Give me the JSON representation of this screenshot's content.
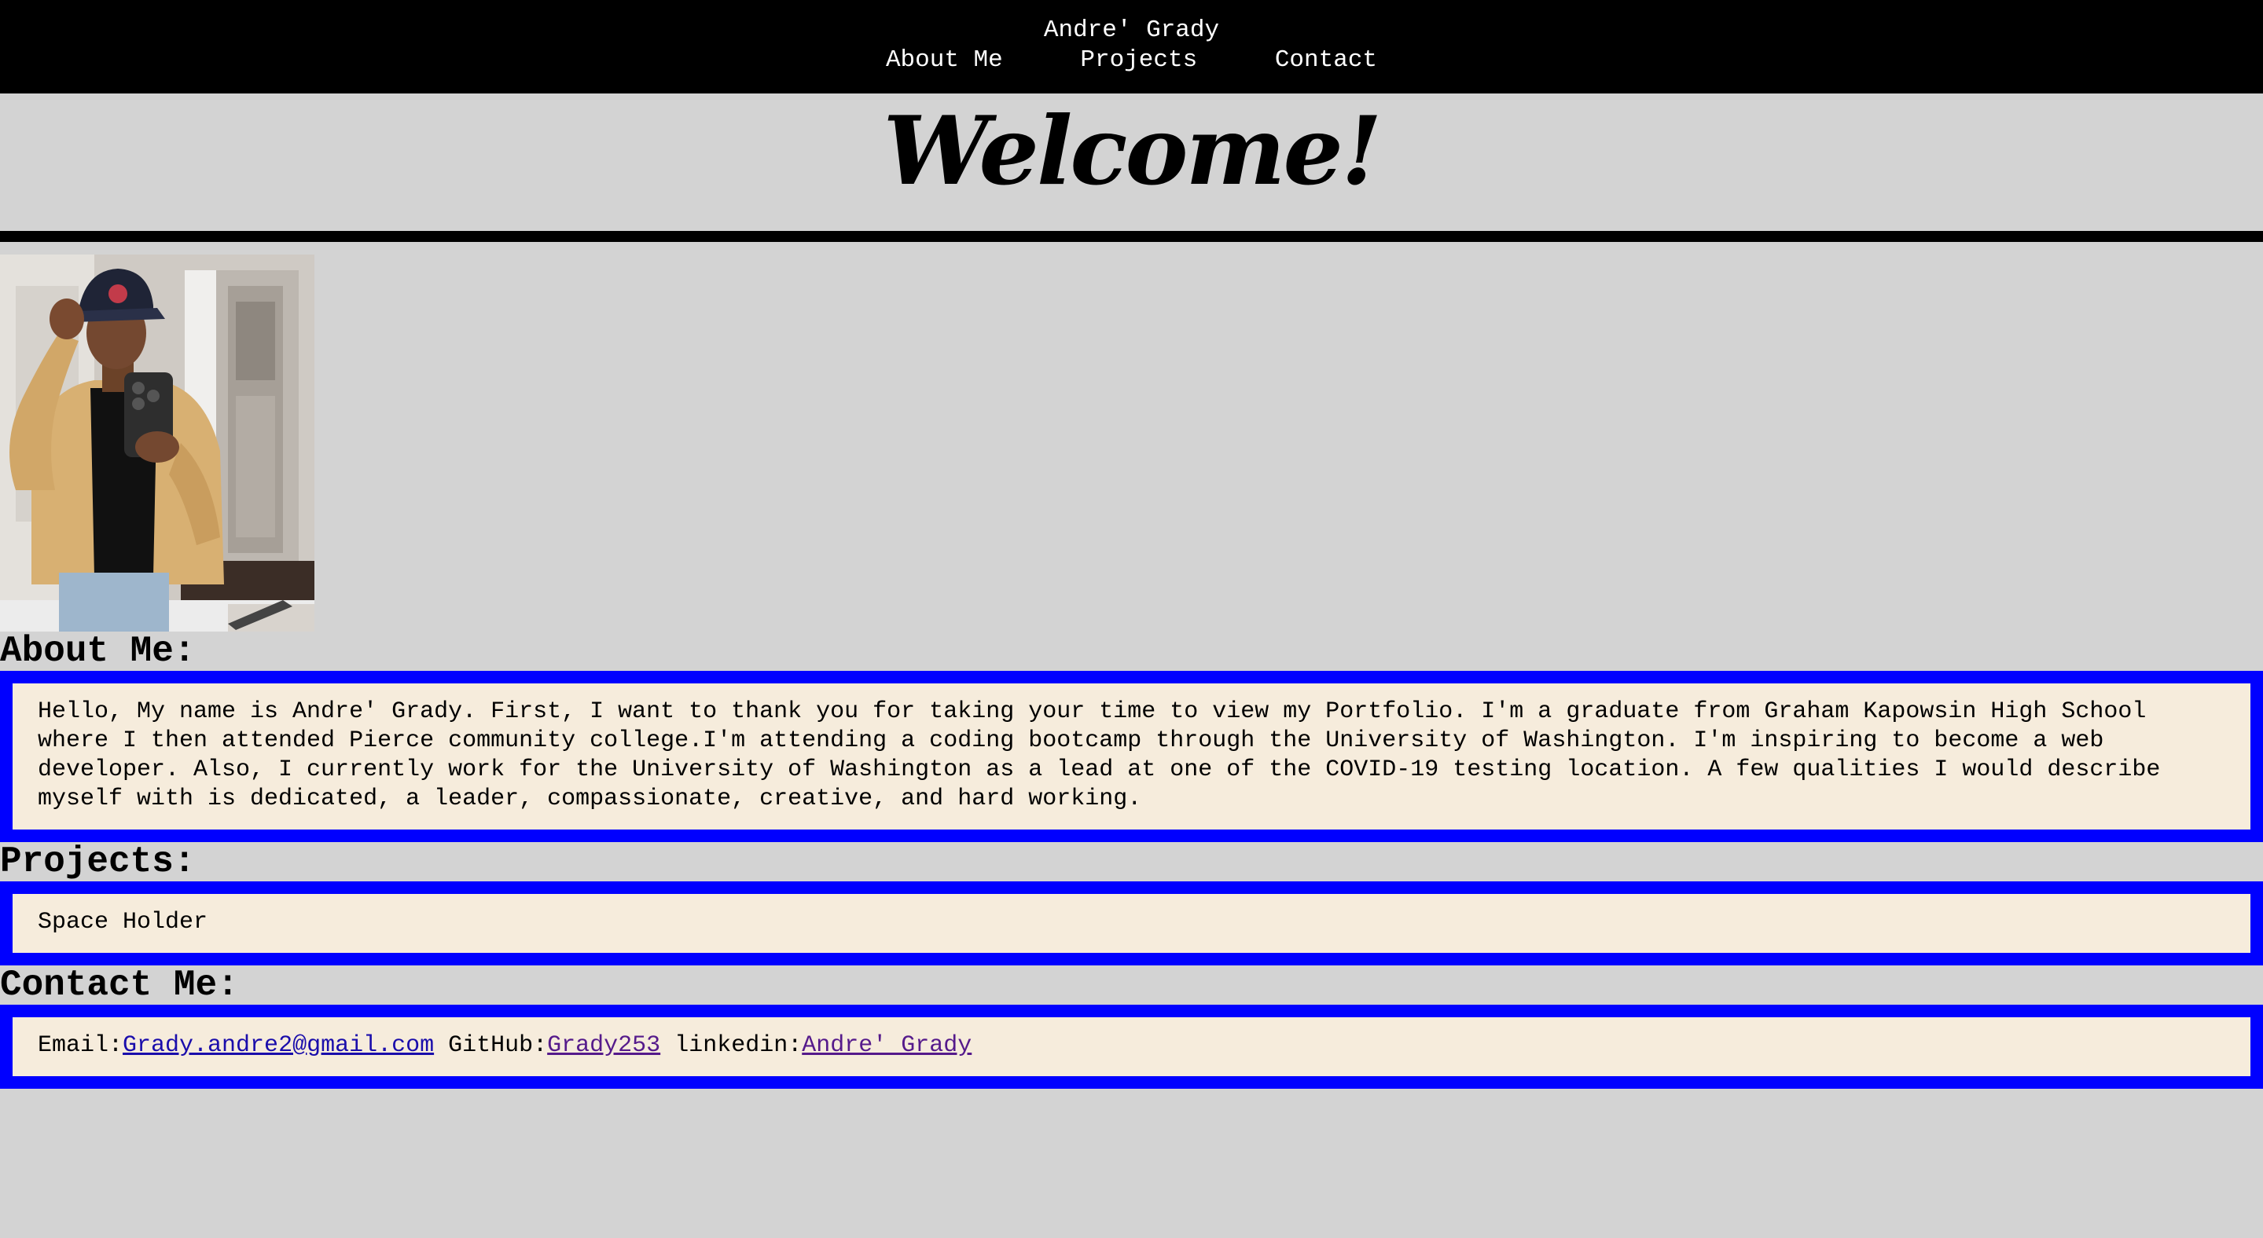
{
  "header": {
    "site_name": "Andre' Grady",
    "nav": [
      "About Me",
      "Projects",
      "Contact"
    ]
  },
  "hero": {
    "title": "Welcome!"
  },
  "profile_photo": {
    "alt": "Andre' Grady"
  },
  "about": {
    "heading": "About Me:",
    "text": "Hello, My name is Andre' Grady. First, I want to thank you for taking your time to view my Portfolio. I'm a graduate from Graham Kapowsin High School where I then attended Pierce community college.I'm attending a coding bootcamp through the University of Washington. I'm inspiring to become a web developer. Also, I currently work for the University of Washington as a lead at one of the COVID-19 testing location. A few qualities I would describe myself with is dedicated, a leader, compassionate, creative, and hard working."
  },
  "projects": {
    "heading": "Projects:",
    "text": "Space Holder"
  },
  "contact": {
    "heading": "Contact Me:",
    "email_label": "Email:",
    "email": "Grady.andre2@gmail.com",
    "github_label": "GitHub:",
    "github": "Grady253",
    "linkedin_label": "linkedin:",
    "linkedin": "Andre' Grady"
  },
  "colors": {
    "page_bg": "#d3d3d3",
    "header_bg": "#000000",
    "box_border": "#0000ff",
    "box_bg": "#f6ecdc",
    "link": "#1a0dab",
    "link_visited": "#551a8b"
  }
}
